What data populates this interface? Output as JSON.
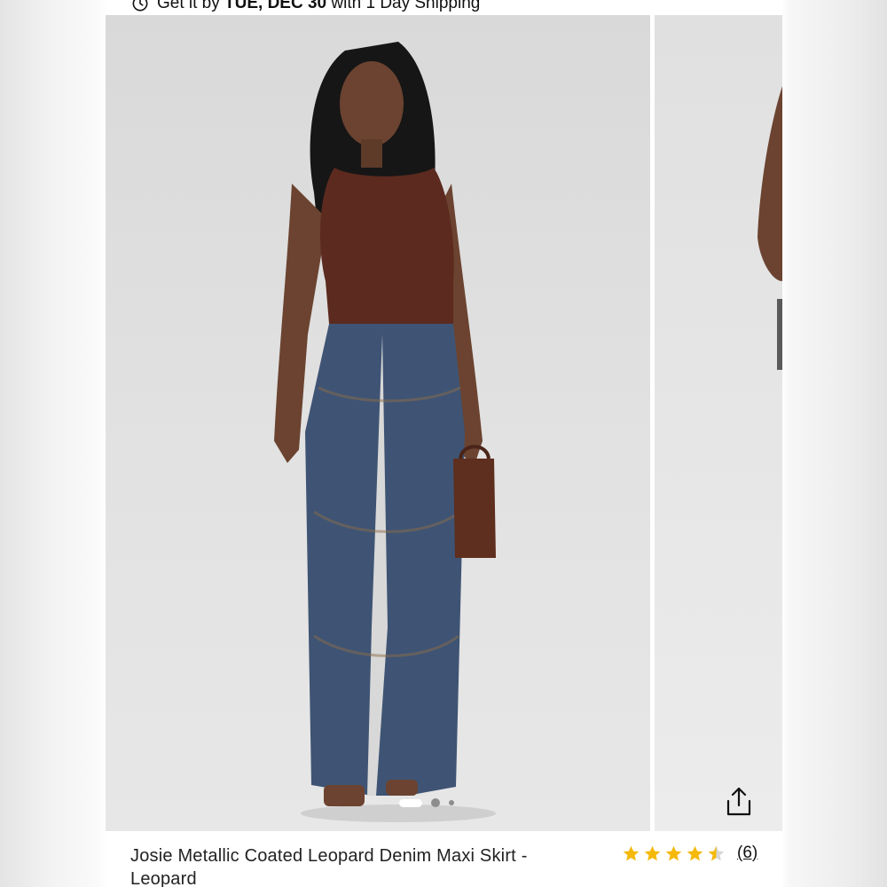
{
  "shipping": {
    "prefix": "Get it by",
    "date": "TUE, DEC 30",
    "suffix": "with 1 Day Shipping",
    "icon": "clock-icon"
  },
  "gallery": {
    "main_image": "model-wearing-metallic-leopard-denim-maxi-skirt",
    "side_image": "model-partial-view",
    "slide_count": 3,
    "active_slide": 1,
    "share_icon": "share-icon"
  },
  "product": {
    "title_line1": "Josie Metallic Coated Leopard Denim Maxi Skirt -",
    "title_line2": "Leopard"
  },
  "rating": {
    "stars": 4.5,
    "count_label": "(6)",
    "star_color": "#f5b90a"
  }
}
